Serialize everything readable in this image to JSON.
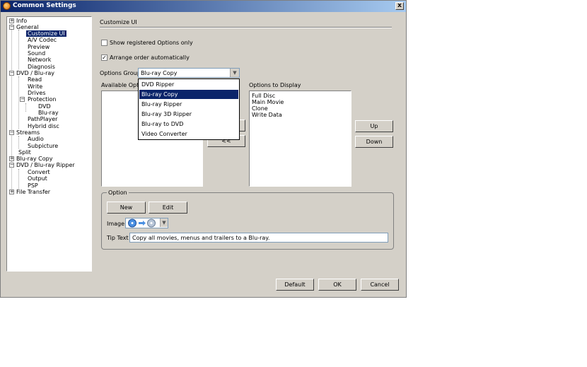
{
  "window": {
    "title": "Common Settings",
    "close_label": "x"
  },
  "tree": {
    "items": [
      {
        "label": "Info"
      },
      {
        "label": "General"
      },
      {
        "label": "Customize UI"
      },
      {
        "label": "A/V Codec"
      },
      {
        "label": "Preview"
      },
      {
        "label": "Sound"
      },
      {
        "label": "Network"
      },
      {
        "label": "Diagnosis"
      },
      {
        "label": "DVD / Blu-ray"
      },
      {
        "label": "Read"
      },
      {
        "label": "Write"
      },
      {
        "label": "Drives"
      },
      {
        "label": "Protection"
      },
      {
        "label": "DVD"
      },
      {
        "label": "Blu-ray"
      },
      {
        "label": "PathPlayer"
      },
      {
        "label": "Hybrid disc"
      },
      {
        "label": "Streams"
      },
      {
        "label": "Audio"
      },
      {
        "label": "Subpicture"
      },
      {
        "label": "Split"
      },
      {
        "label": "Blu-ray Copy"
      },
      {
        "label": "DVD / Blu-ray Ripper"
      },
      {
        "label": "Convert"
      },
      {
        "label": "Output"
      },
      {
        "label": "PSP"
      },
      {
        "label": "File Transfer"
      }
    ],
    "selected": "Customize UI"
  },
  "panel": {
    "title": "Customize UI",
    "show_registered_label": "Show registered Options only",
    "show_registered_checked": false,
    "arrange_label": "Arrange order automatically",
    "arrange_checked": true,
    "options_group_label": "Options Group",
    "options_group_value": "Blu-ray Copy",
    "available_options_label": "Available Options",
    "options_to_display_label": "Options to Display",
    "options_to_display": [
      "Full Disc",
      "Main Movie",
      "Clone",
      "Write Data"
    ],
    "move_right_label": ">>",
    "move_left_label": "<<",
    "up_label": "Up",
    "down_label": "Down"
  },
  "dropdown": {
    "items": [
      "DVD Ripper",
      "Blu-ray Copy",
      "Blu-ray Ripper",
      "Blu-ray 3D Ripper",
      "Blu-ray to DVD",
      "Video Converter"
    ],
    "selected": "Blu-ray Copy"
  },
  "option_group": {
    "legend": "Option",
    "new_label": "New",
    "edit_label": "Edit",
    "image_label": "Image",
    "image_icon": "disc-to-disc-icon",
    "tip_label": "Tip Text",
    "tip_value": "Copy all movies, menus and trailers to a Blu-ray."
  },
  "footer": {
    "default_label": "Default",
    "ok_label": "OK",
    "cancel_label": "Cancel"
  },
  "colors": {
    "dialog": "#d4d0c8",
    "selection": "#0a246a",
    "title_start": "#0a246a",
    "title_end": "#a6caf0"
  }
}
